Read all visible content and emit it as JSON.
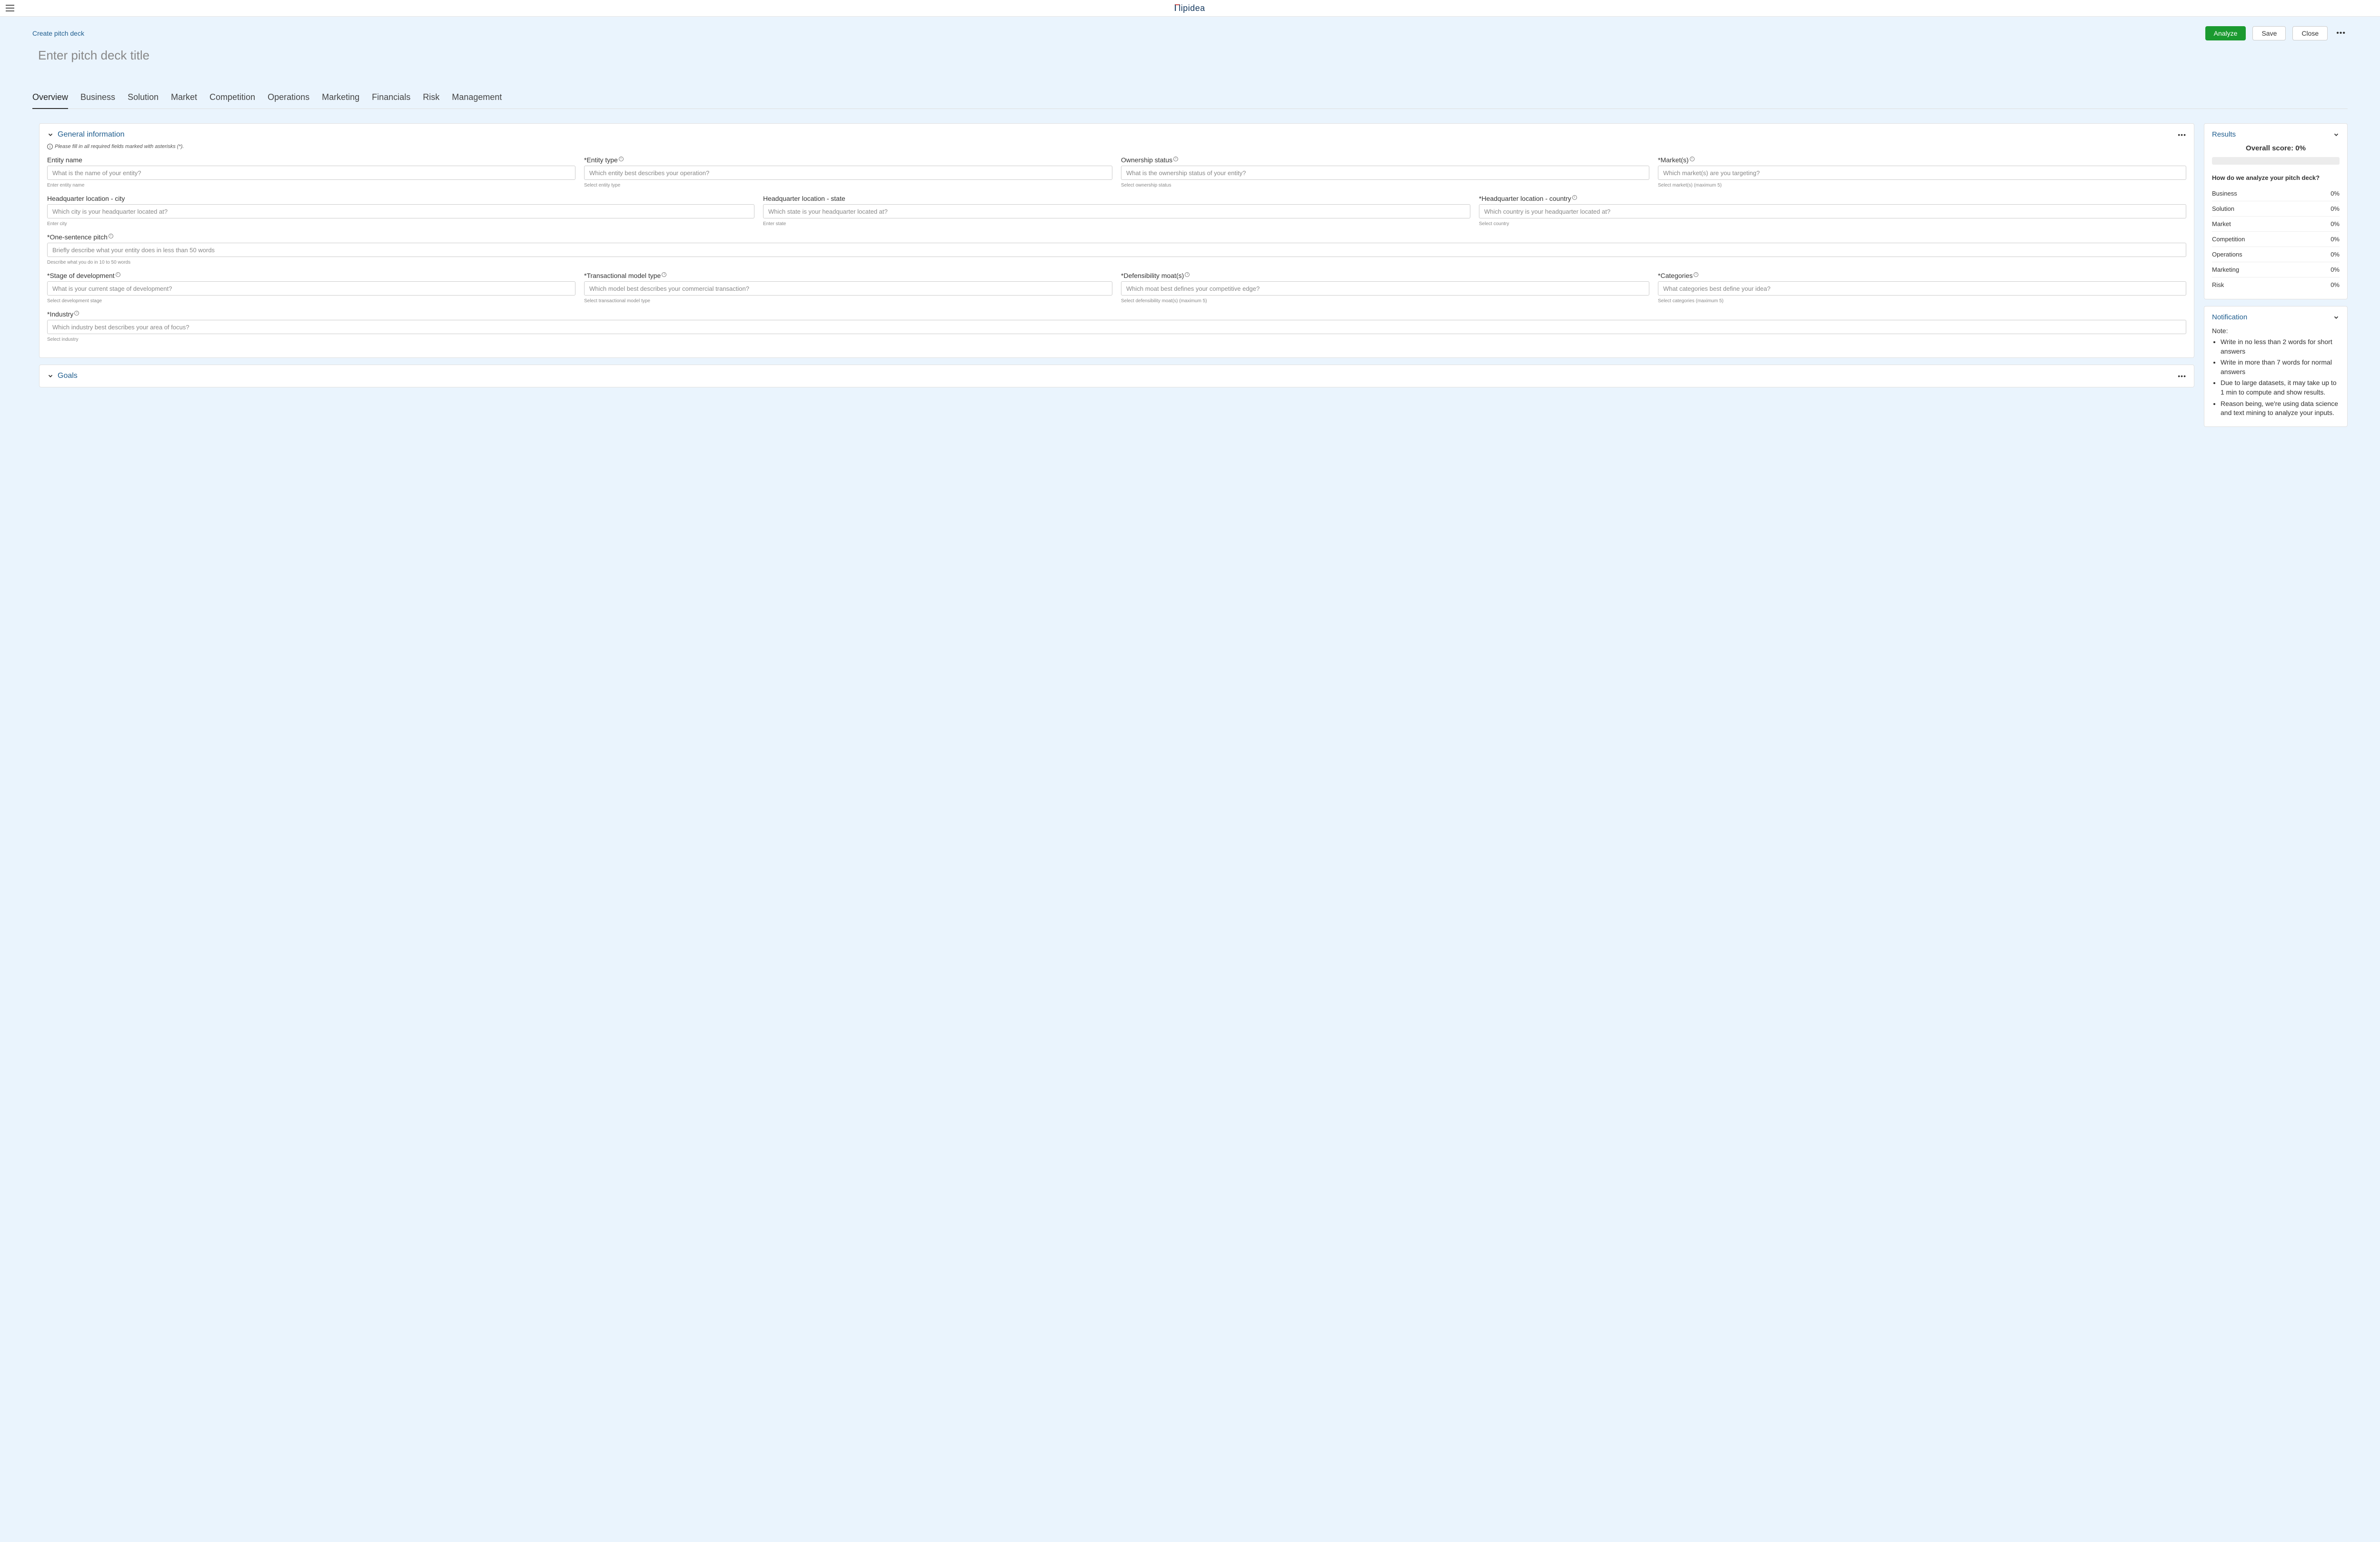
{
  "header": {
    "logo_text": "lipidea"
  },
  "breadcrumb": "Create pitch deck",
  "actions": {
    "analyze": "Analyze",
    "save": "Save",
    "close": "Close"
  },
  "title_placeholder": "Enter pitch deck title",
  "tabs": [
    "Overview",
    "Business",
    "Solution",
    "Market",
    "Competition",
    "Operations",
    "Marketing",
    "Financials",
    "Risk",
    "Management"
  ],
  "general": {
    "section_title": "General information",
    "required_note": "Please fill in all required fields marked with asterisks (*).",
    "fields": {
      "entity_name": {
        "label": "Entity name",
        "placeholder": "What is the name of your entity?",
        "hint": "Enter entity name",
        "required": false,
        "info": false
      },
      "entity_type": {
        "label": "Entity type",
        "placeholder": "Which entity best describes your operation?",
        "hint": "Select entity type",
        "required": true,
        "info": true
      },
      "ownership_status": {
        "label": "Ownership status",
        "placeholder": "What is the ownership status of your entity?",
        "hint": "Select ownership status",
        "required": false,
        "info": true
      },
      "markets": {
        "label": "Market(s)",
        "placeholder": "Which market(s) are you targeting?",
        "hint": "Select market(s) (maximum 5)",
        "required": true,
        "info": true
      },
      "hq_city": {
        "label": "Headquarter location - city",
        "placeholder": "Which city is your headquarter located at?",
        "hint": "Enter city",
        "required": false,
        "info": false
      },
      "hq_state": {
        "label": "Headquarter location - state",
        "placeholder": "Which state is your headquarter located at?",
        "hint": "Enter state",
        "required": false,
        "info": false
      },
      "hq_country": {
        "label": "Headquarter location - country",
        "placeholder": "Which country is your headquarter located at?",
        "hint": "Select country",
        "required": true,
        "info": true
      },
      "pitch": {
        "label": "One-sentence pitch",
        "placeholder": "Briefly describe what your entity does in less than 50 words",
        "hint": "Describe what you do in 10 to 50 words",
        "required": true,
        "info": true
      },
      "stage": {
        "label": "Stage of development",
        "placeholder": "What is your current stage of development?",
        "hint": "Select development stage",
        "required": true,
        "info": true
      },
      "transactional": {
        "label": "Transactional model type",
        "placeholder": "Which model best describes your commercial transaction?",
        "hint": "Select transactional model type",
        "required": true,
        "info": true
      },
      "moat": {
        "label": "Defensibility moat(s)",
        "placeholder": "Which moat best defines your competitive edge?",
        "hint": "Select defensibility moat(s) (maximum 5)",
        "required": true,
        "info": true
      },
      "categories": {
        "label": "Categories",
        "placeholder": "What categories best define your idea?",
        "hint": "Select categories (maximum 5)",
        "required": true,
        "info": true
      },
      "industry": {
        "label": "Industry",
        "placeholder": "Which industry best describes your area of focus?",
        "hint": "Select industry",
        "required": true,
        "info": true
      }
    }
  },
  "goals": {
    "section_title": "Goals"
  },
  "results": {
    "title": "Results",
    "overall_label": "Overall score: 0%",
    "question": "How do we analyze your pitch deck?",
    "rows": [
      {
        "name": "Business",
        "value": "0%"
      },
      {
        "name": "Solution",
        "value": "0%"
      },
      {
        "name": "Market",
        "value": "0%"
      },
      {
        "name": "Competition",
        "value": "0%"
      },
      {
        "name": "Operations",
        "value": "0%"
      },
      {
        "name": "Marketing",
        "value": "0%"
      },
      {
        "name": "Risk",
        "value": "0%"
      }
    ]
  },
  "notification": {
    "title": "Notification",
    "note_label": "Note:",
    "items": [
      "Write in no less than 2 words for short answers",
      "Write in more than 7 words for normal answers",
      "Due to large datasets, it may take up to 1 min to compute and show results.",
      "Reason being, we're using data science and text mining to analyze your inputs."
    ]
  }
}
